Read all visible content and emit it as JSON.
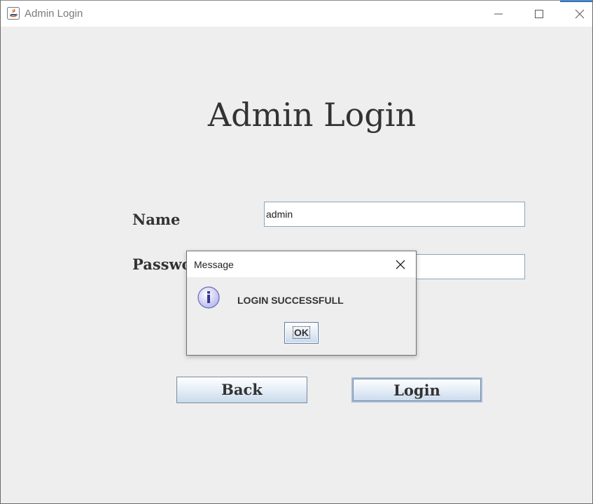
{
  "window": {
    "title": "Admin Login"
  },
  "dialog": {
    "title": "Message",
    "message": "LOGIN SUCCESSFULL",
    "ok_label": "OK",
    "icon": "info-icon"
  },
  "form": {
    "heading": "Admin Login",
    "name_label": "Name",
    "name_value": "admin",
    "password_label": "Password",
    "password_value": "",
    "back_label": "Back",
    "login_label": "Login"
  },
  "colors": {
    "background": "#eeeeee",
    "accent": "#1e78d7",
    "button_border": "#7a8aa0"
  }
}
